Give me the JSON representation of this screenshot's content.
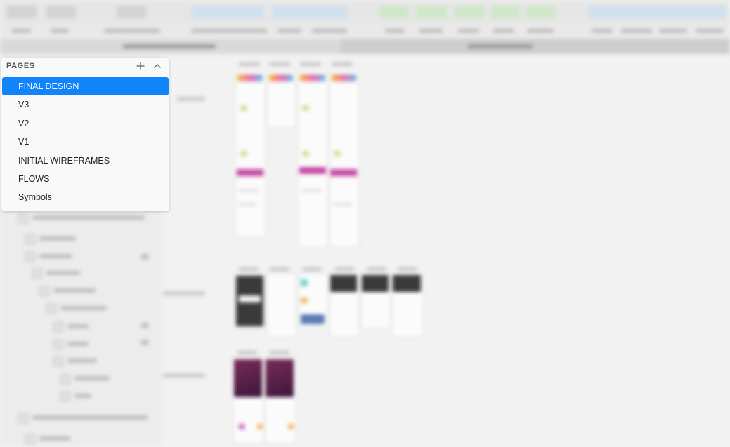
{
  "pages_panel": {
    "title": "PAGES",
    "add_icon": "plus-icon",
    "collapse_icon": "chevron-up-icon",
    "items": [
      {
        "label": "FINAL DESIGN",
        "selected": true
      },
      {
        "label": "V3",
        "selected": false
      },
      {
        "label": "V2",
        "selected": false
      },
      {
        "label": "V1",
        "selected": false
      },
      {
        "label": "INITIAL WIREFRAMES",
        "selected": false
      },
      {
        "label": "FLOWS",
        "selected": false
      },
      {
        "label": "Symbols",
        "selected": false
      }
    ]
  },
  "colors": {
    "selection": "#1183fb",
    "popover_bg": "#f9f9f9",
    "canvas_bg": "#f2f2f2"
  }
}
